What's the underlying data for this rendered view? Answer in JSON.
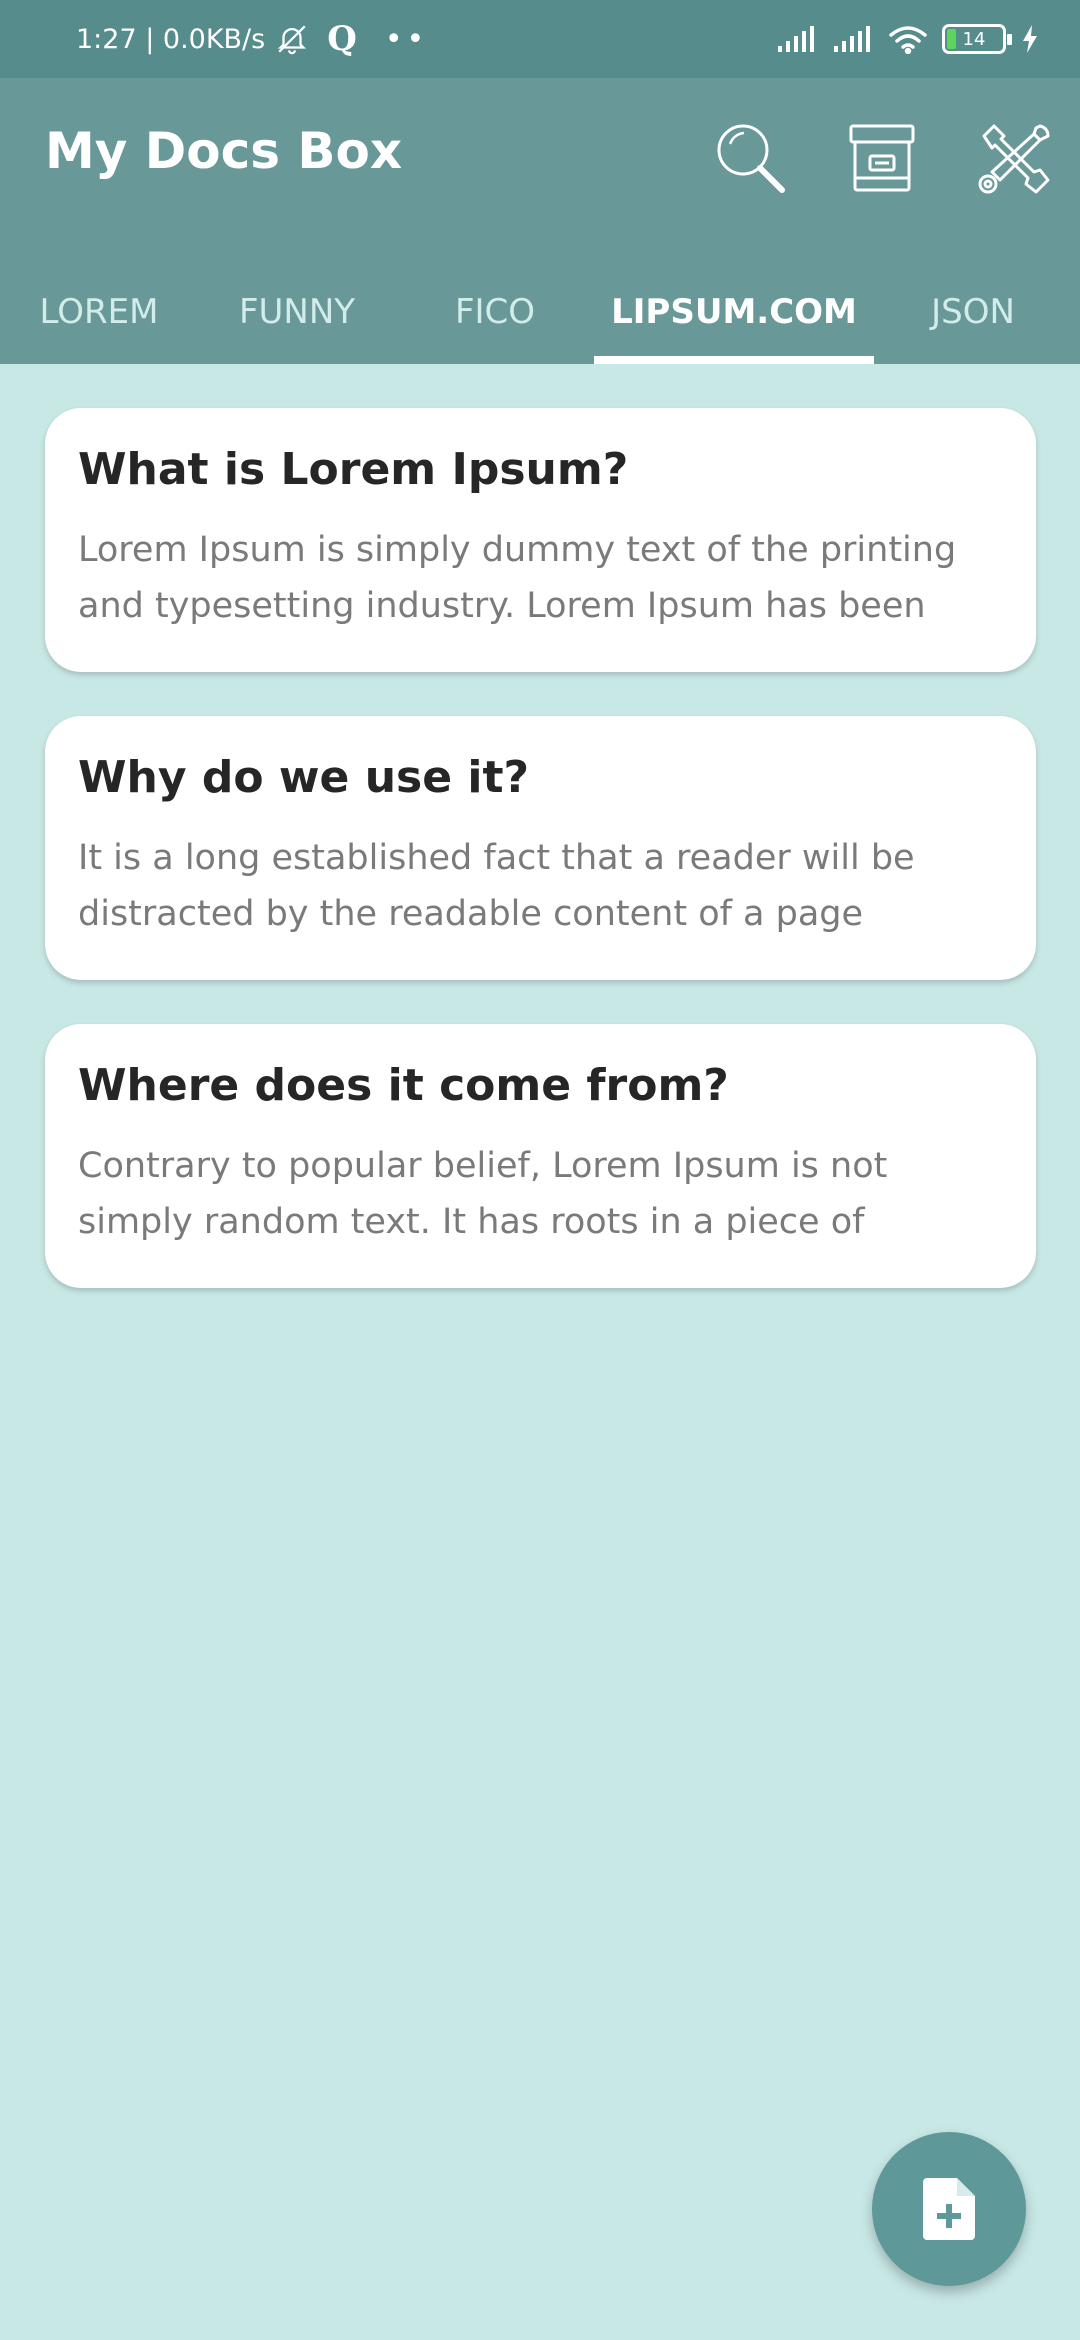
{
  "status_bar": {
    "time_speed": "1:27 | 0.0KB/s",
    "dots": "••",
    "battery_level": "14",
    "icons": [
      "bell-off-icon",
      "q-app-icon",
      "signal-icon",
      "signal-icon",
      "wifi-icon",
      "battery-icon",
      "charging-icon"
    ]
  },
  "app_bar": {
    "title": "My Docs Box",
    "actions": [
      "search-icon",
      "archive-icon",
      "tools-icon"
    ],
    "background": "#689898"
  },
  "tabs": [
    {
      "label": "LOREM",
      "active": false
    },
    {
      "label": "FUNNY",
      "active": false
    },
    {
      "label": "FICO",
      "active": false
    },
    {
      "label": "LIPSUM.COM",
      "active": true
    },
    {
      "label": "JSON",
      "active": false
    }
  ],
  "cards": [
    {
      "title": "What is Lorem Ipsum?",
      "body": "Lorem Ipsum is simply dummy text of the printing and typesetting industry. Lorem Ipsum has been the"
    },
    {
      "title": "Why do we use it?",
      "body": "It is a long established fact that a reader will be distracted by the readable content of a page when"
    },
    {
      "title": "Where does it come from?",
      "body": "Contrary to popular belief, Lorem Ipsum is not simply random text. It has roots in a piece of classical"
    }
  ],
  "fab": {
    "icon": "add-document-icon"
  },
  "colors": {
    "status_bar": "#578c8c",
    "app_bar": "#689898",
    "background": "#c8e8e6",
    "card": "#ffffff",
    "fab": "#5e9898"
  }
}
